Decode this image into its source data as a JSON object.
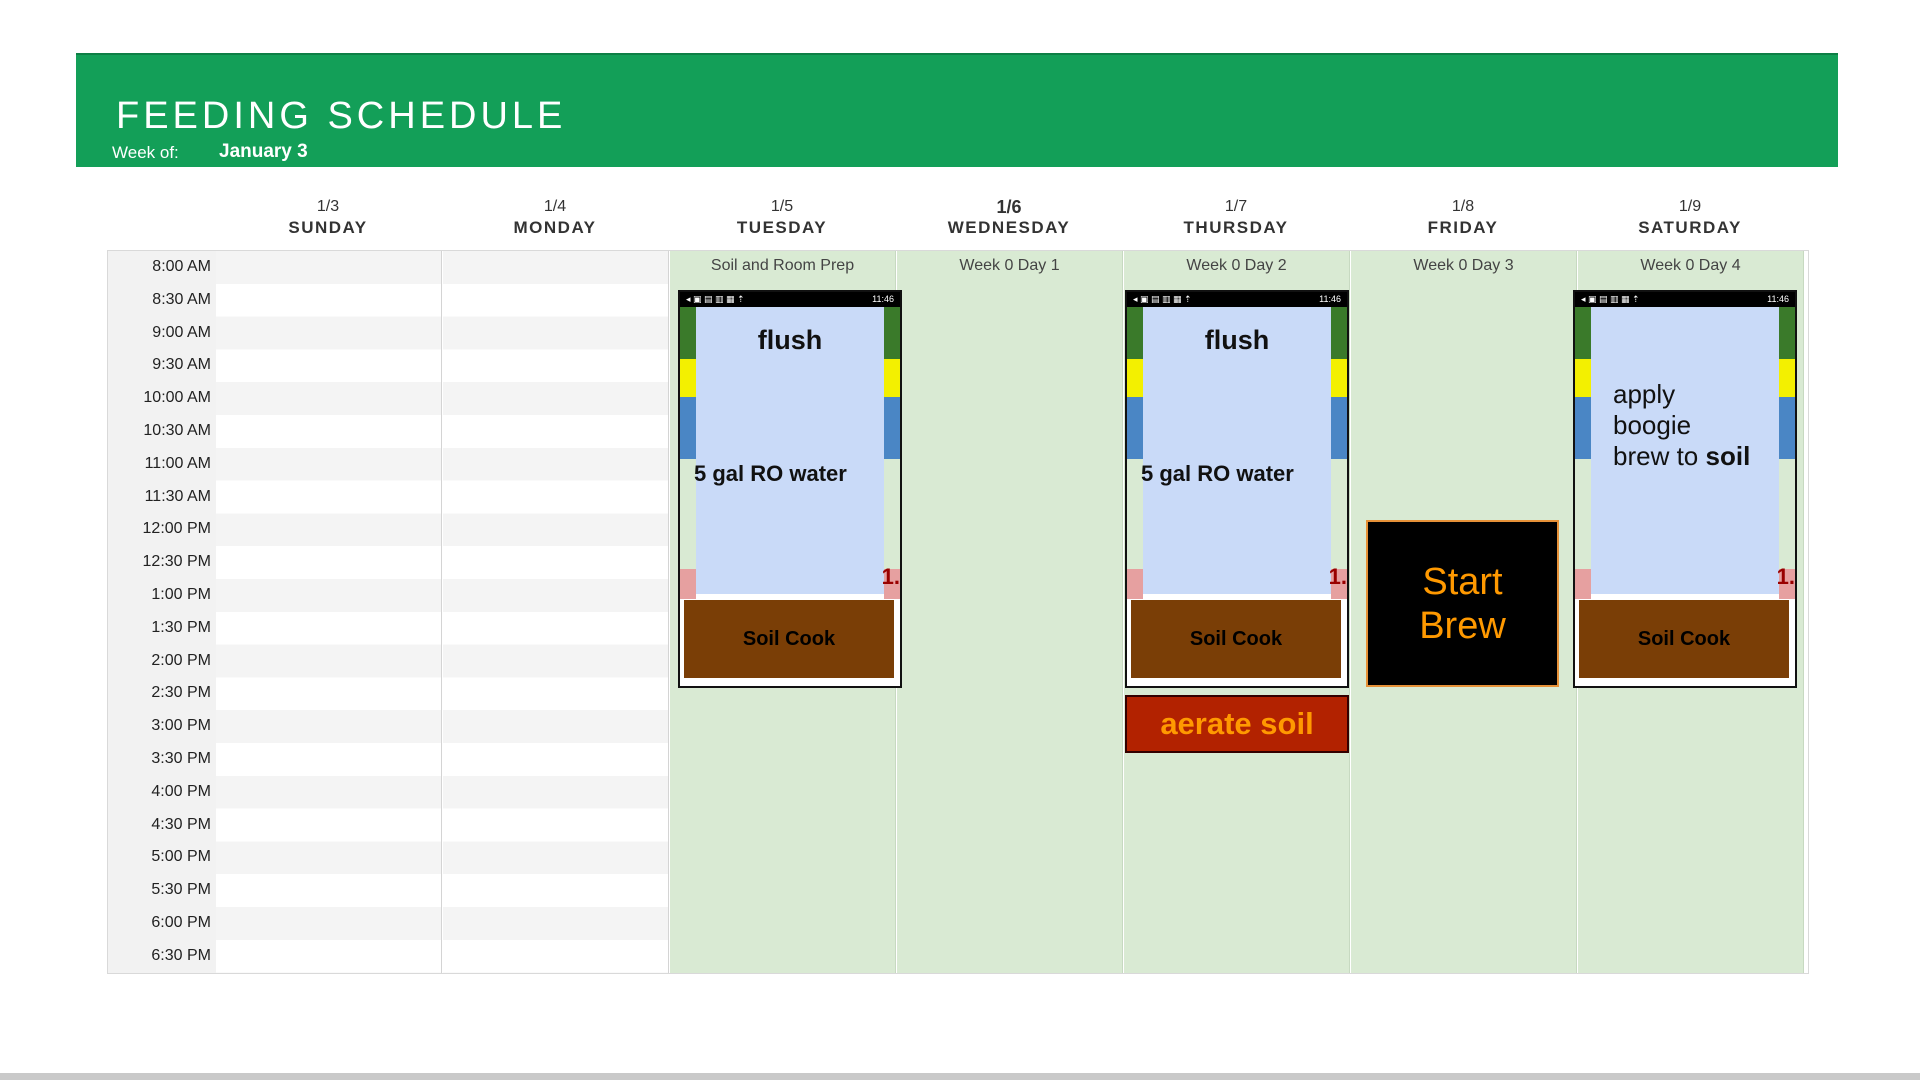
{
  "header": {
    "title": "FEEDING SCHEDULE",
    "week_of_label": "Week of:",
    "week_of_value": "January 3"
  },
  "days": [
    {
      "date": "1/3",
      "name": "SUNDAY",
      "label": ""
    },
    {
      "date": "1/4",
      "name": "MONDAY",
      "label": ""
    },
    {
      "date": "1/5",
      "name": "TUESDAY",
      "label": "Soil and Room Prep"
    },
    {
      "date": "1/6",
      "name": "WEDNESDAY",
      "label": "Week 0 Day 1"
    },
    {
      "date": "1/7",
      "name": "THURSDAY",
      "label": "Week 0 Day 2"
    },
    {
      "date": "1/8",
      "name": "FRIDAY",
      "label": "Week 0 Day 3"
    },
    {
      "date": "1/9",
      "name": "SATURDAY",
      "label": "Week 0 Day 4"
    }
  ],
  "times": [
    "8:00 AM",
    "8:30 AM",
    "9:00 AM",
    "9:30 AM",
    "10:00 AM",
    "10:30 AM",
    "11:00 AM",
    "11:30 AM",
    "12:00 PM",
    "12:30 PM",
    "1:00 PM",
    "1:30 PM",
    "2:00 PM",
    "2:30 PM",
    "3:00 PM",
    "3:30 PM",
    "4:00 PM",
    "4:30 PM",
    "5:00 PM",
    "5:30 PM",
    "6:00 PM",
    "6:30 PM"
  ],
  "events": {
    "tuesday": {
      "status_time": "11:46",
      "title": "flush",
      "detail": "5 gal RO water",
      "num": "1.",
      "soil": "Soil Cook"
    },
    "thursday": {
      "status_time": "11:46",
      "title": "flush",
      "detail": "5 gal RO water",
      "num": "1.",
      "soil": "Soil Cook"
    },
    "saturday": {
      "status_time": "11:46",
      "line1": "apply",
      "line2": "boogie",
      "line3_a": "brew to ",
      "line3_b": "soil",
      "num": "1.",
      "soil": "Soil Cook"
    },
    "friday_brew": {
      "line1": "Start",
      "line2": "Brew"
    },
    "thursday_aerate": "aerate soil"
  },
  "colors": {
    "header_green": "#139f58",
    "active_day_bg": "#d9ead3",
    "card_blue": "#c9daf8",
    "soil_brown": "#7a3e06",
    "brew_orange": "#ff9900",
    "aerate_red": "#b22200"
  }
}
